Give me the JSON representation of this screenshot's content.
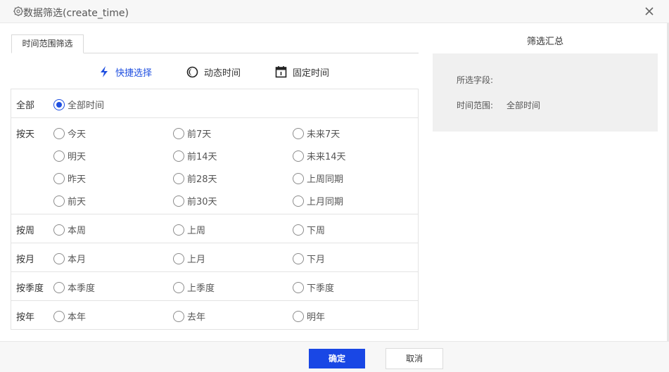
{
  "dialog": {
    "title": "数据筛选(create_time)",
    "title_icon": "gear-icon",
    "close_icon": "close-icon"
  },
  "tab": {
    "label": "时间范围筛选"
  },
  "modes": [
    {
      "label": "快捷选择",
      "icon": "lightning-icon",
      "active": true
    },
    {
      "label": "动态时间",
      "icon": "moon-icon",
      "active": false
    },
    {
      "label": "固定时间",
      "icon": "calendar-icon",
      "active": false
    }
  ],
  "groups": [
    {
      "label": "全部",
      "options": [
        "全部时间"
      ]
    },
    {
      "label": "按天",
      "options": [
        "今天",
        "前7天",
        "未来7天",
        "明天",
        "前14天",
        "未来14天",
        "昨天",
        "前28天",
        "上周同期",
        "前天",
        "前30天",
        "上月同期"
      ]
    },
    {
      "label": "按周",
      "options": [
        "本周",
        "上周",
        "下周"
      ]
    },
    {
      "label": "按月",
      "options": [
        "本月",
        "上月",
        "下月"
      ]
    },
    {
      "label": "按季度",
      "options": [
        "本季度",
        "上季度",
        "下季度"
      ]
    },
    {
      "label": "按年",
      "options": [
        "本年",
        "去年",
        "明年"
      ]
    }
  ],
  "selected_option": "全部时间",
  "summary": {
    "title": "筛选汇总",
    "field_label": "所选字段:",
    "field_value": "",
    "range_label": "时间范围:",
    "range_value": "全部时间"
  },
  "footer": {
    "ok_label": "确定",
    "cancel_label": "取消"
  },
  "colors": {
    "accent": "#1f4fe0",
    "ok_button": "#1947e5",
    "summary_bg": "#f0f0f0"
  }
}
